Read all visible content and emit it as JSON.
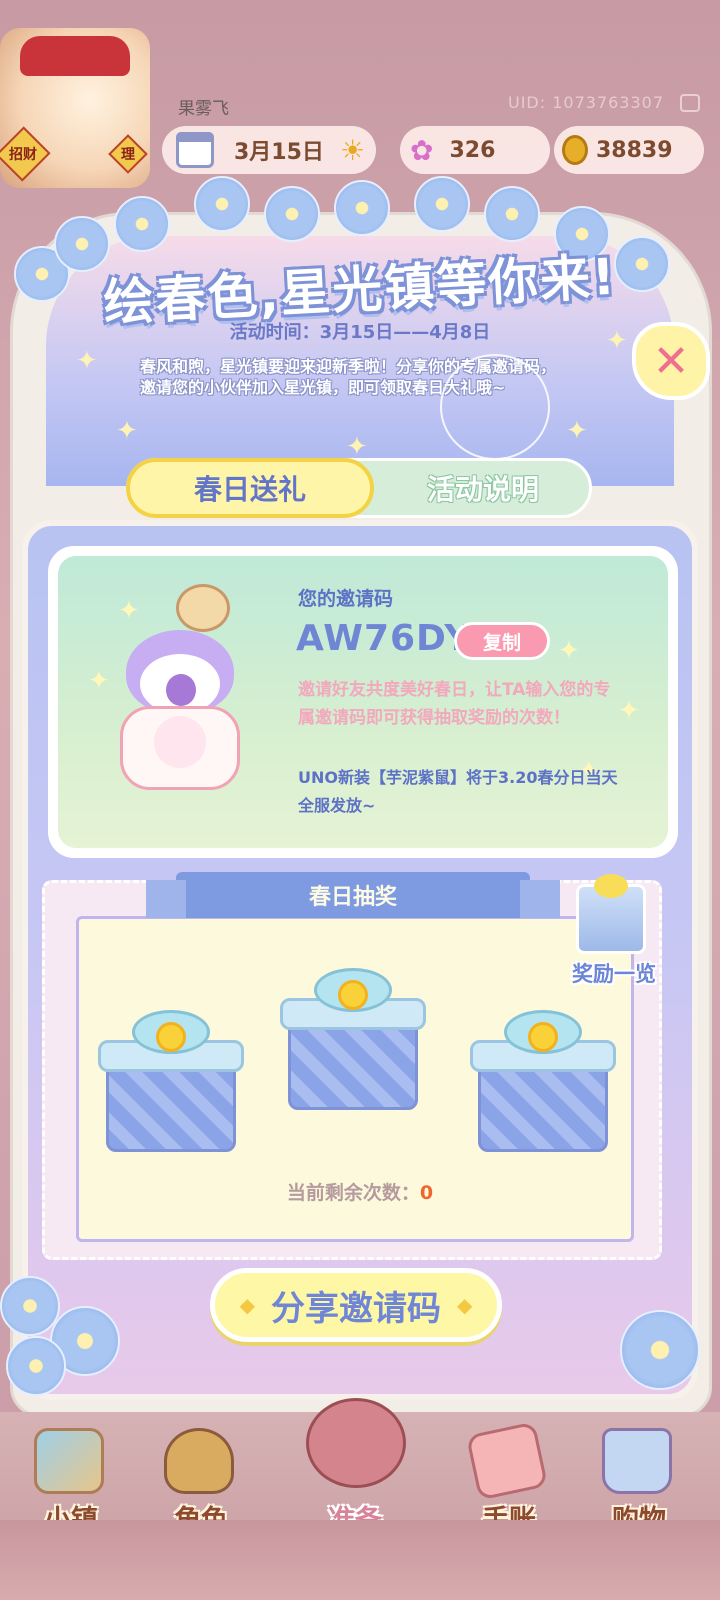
{
  "hud": {
    "player_name": "果雾飞",
    "uid": "UID: 1073763307",
    "date": "3月15日",
    "gems": "326",
    "coins": "38839",
    "avatar_sign_left": "招财",
    "avatar_sign_right": "理"
  },
  "event": {
    "title": "绘春色,星光镇等你来!",
    "time": "活动时间：3月15日——4月8日",
    "description": "春风和煦，星光镇要迎来迎新季啦！分享你的专属邀请码，邀请您的小伙伴加入星光镇，即可领取春日大礼哦~",
    "close_symbol": "✕"
  },
  "tabs": [
    {
      "label": "春日送礼",
      "active": true
    },
    {
      "label": "活动说明",
      "active": false
    }
  ],
  "invite": {
    "label": "您的邀请码",
    "code": "AW76DY",
    "copy_label": "复制",
    "description": "邀请好友共度美好春日，让TA输入您的专属邀请码即可获得抽取奖励的次数！",
    "news": "UNO新装【芋泥紫鼠】将于3.20春分日当天全服发放~"
  },
  "lottery": {
    "title": "春日抽奖",
    "reward_list_label": "奖励一览",
    "remaining_label": "当前剩余次数：",
    "remaining_count": "0"
  },
  "share_button": "分享邀请码",
  "bottom_nav": [
    {
      "label": "小镇",
      "icon": "map-icon"
    },
    {
      "label": "角色",
      "icon": "character-icon"
    },
    {
      "label": "准备",
      "icon": "prepare-icon"
    },
    {
      "label": "手账",
      "icon": "journal-icon"
    },
    {
      "label": "购物",
      "icon": "shopping-bag-icon"
    }
  ],
  "colors": {
    "accent_blue": "#6f86d6",
    "button_yellow": "#fef7a5",
    "copy_pink": "#f99ab0",
    "count_orange": "#f0652e"
  }
}
